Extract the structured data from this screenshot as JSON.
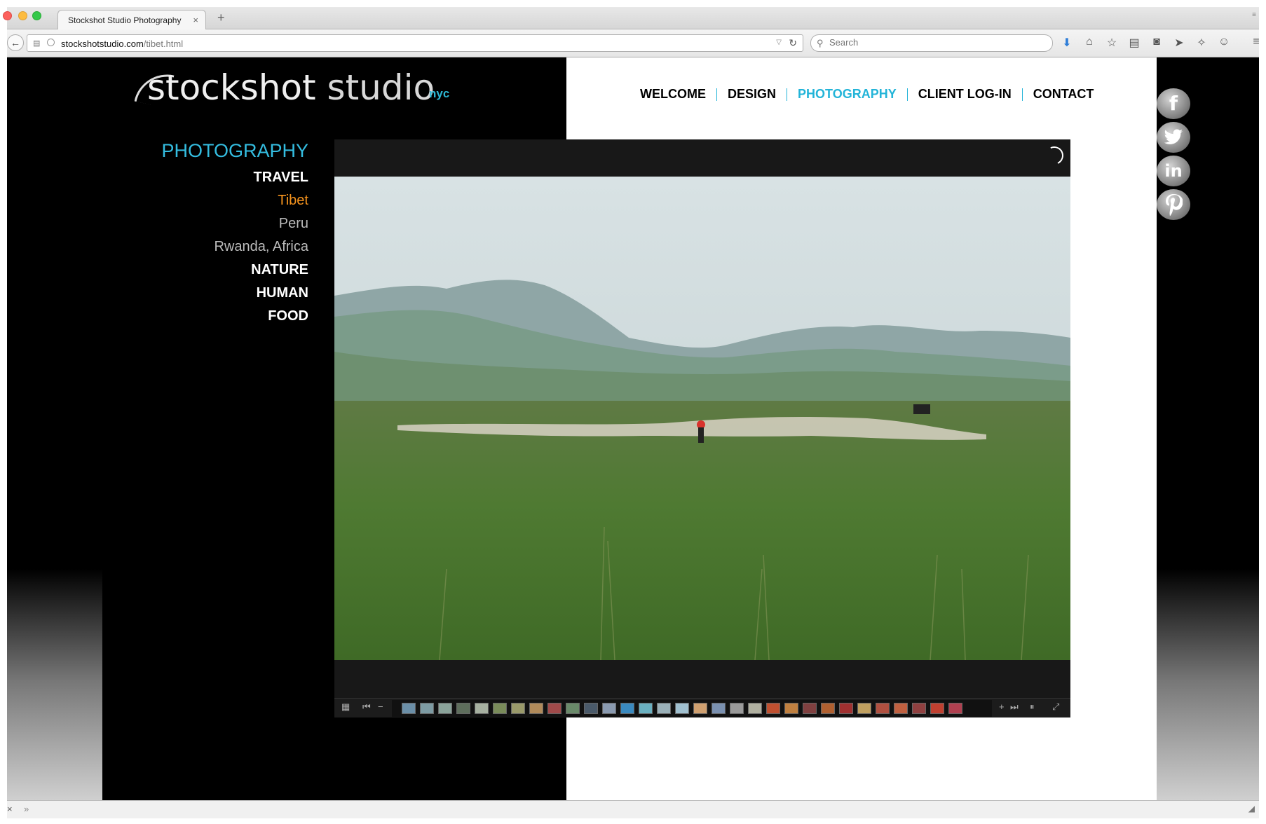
{
  "browser": {
    "tab_title": "Stockshot Studio Photography",
    "tab_close": "×",
    "new_tab": "+",
    "url_domain": "stockshotstudio.com",
    "url_path": "/tibet.html",
    "search_placeholder": "Search"
  },
  "site": {
    "logo_word1": "stockshot",
    "logo_word2": "studio",
    "logo_suffix": "nyc",
    "accent_color": "#23b4d8",
    "active_sub_color": "#f7941d"
  },
  "topnav": {
    "items": [
      "WELCOME",
      "DESIGN",
      "PHOTOGRAPHY",
      "CLIENT LOG-IN",
      "CONTACT"
    ]
  },
  "sidenav": {
    "heading": "PHOTOGRAPHY",
    "travel": "TRAVEL",
    "sub": [
      "Tibet",
      "Peru",
      "Rwanda, Africa"
    ],
    "nature": "NATURE",
    "human": "HUMAN",
    "food": "FOOD"
  },
  "social": {
    "facebook": "f",
    "linkedin": "in",
    "icons": [
      "facebook-icon",
      "twitter-icon",
      "linkedin-icon",
      "pinterest-icon"
    ]
  },
  "gallery": {
    "thumb_colors": [
      "#6b8fa8",
      "#7d9ba3",
      "#8aa39a",
      "#5e6e5c",
      "#a6b0a0",
      "#7a8c5a",
      "#9a9a6a",
      "#b08a5a",
      "#a04a4a",
      "#6a8a6a",
      "#4a5a6a",
      "#8a9ab0",
      "#3a8ac0",
      "#6ab0c0",
      "#9ab0b8",
      "#a0c0d0",
      "#d0a070",
      "#7a90b0",
      "#9a9a9a",
      "#b0b0a0",
      "#c05030",
      "#c08040",
      "#804040",
      "#b06030",
      "#a03030",
      "#c0a060",
      "#b05040",
      "#c06040",
      "#904040",
      "#c04030",
      "#b04050"
    ]
  }
}
